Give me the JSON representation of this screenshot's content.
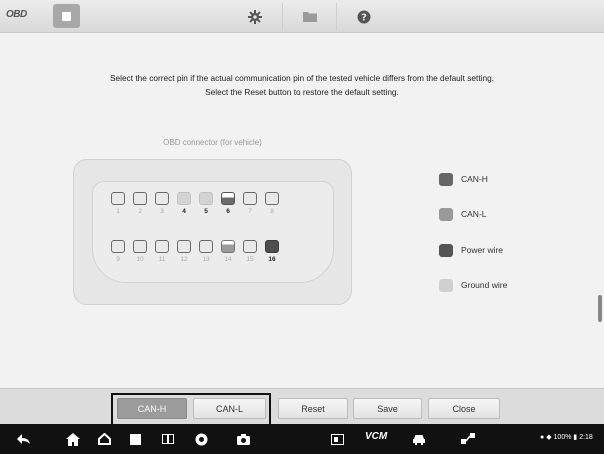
{
  "topbar": {
    "logo": "OBD",
    "tools": [
      {
        "name": "settings",
        "icon": "gear-icon"
      },
      {
        "name": "folder",
        "icon": "folder-icon"
      },
      {
        "name": "help",
        "icon": "help-icon"
      }
    ]
  },
  "instructions": {
    "line1": "Select the correct pin if the actual communication pin of the tested vehicle differs from the default setting.",
    "line2": "Select the Reset button to restore the default setting."
  },
  "connector": {
    "label": "OBD connector (for vehicle)",
    "pins": [
      {
        "num": "1",
        "type": "none",
        "active": false
      },
      {
        "num": "2",
        "type": "none",
        "active": false
      },
      {
        "num": "3",
        "type": "none",
        "active": false
      },
      {
        "num": "4",
        "type": "ground",
        "active": true
      },
      {
        "num": "5",
        "type": "ground",
        "active": true
      },
      {
        "num": "6",
        "type": "canh",
        "active": true
      },
      {
        "num": "7",
        "type": "none",
        "active": false
      },
      {
        "num": "8",
        "type": "none",
        "active": false
      },
      {
        "num": "9",
        "type": "none",
        "active": false
      },
      {
        "num": "10",
        "type": "none",
        "active": false
      },
      {
        "num": "11",
        "type": "none",
        "active": false
      },
      {
        "num": "12",
        "type": "none",
        "active": false
      },
      {
        "num": "13",
        "type": "none",
        "active": false
      },
      {
        "num": "14",
        "type": "canl",
        "active": false
      },
      {
        "num": "15",
        "type": "none",
        "active": false
      },
      {
        "num": "16",
        "type": "power",
        "active": true
      }
    ]
  },
  "legend": [
    {
      "label": "CAN-H",
      "color": "#666666"
    },
    {
      "label": "CAN-L",
      "color": "#999999"
    },
    {
      "label": "Power wire",
      "color": "#555555"
    },
    {
      "label": "Ground wire",
      "color": "#d0d0d0"
    }
  ],
  "buttons": {
    "canh": "CAN-H",
    "canl": "CAN-L",
    "reset": "Reset",
    "save": "Save",
    "close": "Close"
  },
  "navbar": {
    "vcm": "VCM",
    "status": "100%",
    "time": "2:18"
  },
  "colors": {
    "accent": "#9b9b9b",
    "navbar": "#111111"
  }
}
